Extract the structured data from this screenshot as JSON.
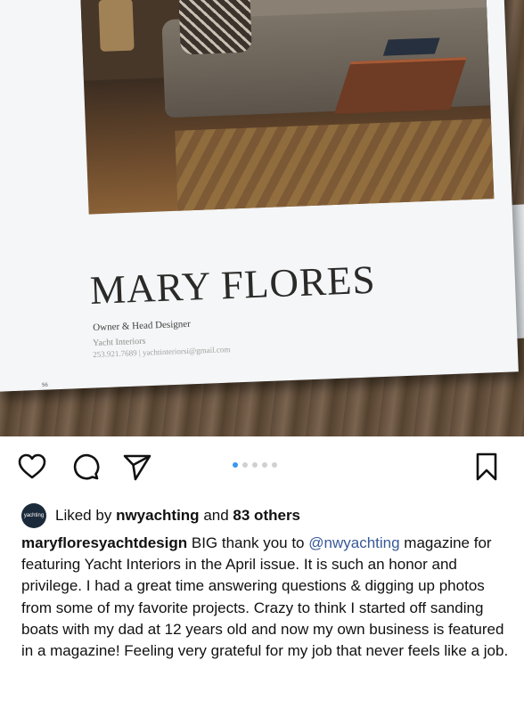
{
  "magazine_page": {
    "name": "MARY FLORES",
    "role": "Owner & Head Designer",
    "company": "Yacht Interiors",
    "contact": "253.921.7689 | yachtinteriorsi@gmail.com",
    "page_number": "56"
  },
  "actions": {
    "like_icon": "heart-icon",
    "comment_icon": "comment-icon",
    "share_icon": "paper-plane-icon",
    "save_icon": "bookmark-icon",
    "carousel_count": 5,
    "carousel_active": 1,
    "accent_color": "#3897f0"
  },
  "likes": {
    "avatar_text": "yachting",
    "prefix": "Liked by",
    "user": "nwyachting",
    "conjunction": "and",
    "others": "83 others"
  },
  "caption": {
    "username": "maryfloresyachtdesign",
    "text_before": "BIG thank you to",
    "mention": "@nwyachting",
    "text_after": "magazine for featuring Yacht Interiors in the April issue. It is such an honor and privilege. I had a great time answering questions & digging up photos from some of my favorite projects. Crazy to think I started off sanding boats with my dad at 12 years old and now my own business is featured in a magazine! Feeling very grateful for my job that never feels like a job."
  }
}
